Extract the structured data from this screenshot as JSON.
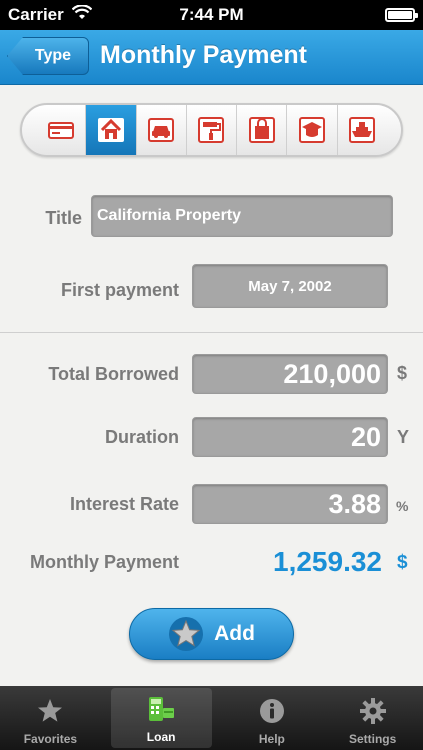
{
  "status_bar": {
    "carrier": "Carrier",
    "time": "7:44 PM"
  },
  "nav": {
    "back_label": "Type",
    "title": "Monthly Payment"
  },
  "type_selector": {
    "items": [
      {
        "icon": "credit-card-icon",
        "selected": false
      },
      {
        "icon": "house-icon",
        "selected": true
      },
      {
        "icon": "car-icon",
        "selected": false
      },
      {
        "icon": "paint-roller-icon",
        "selected": false
      },
      {
        "icon": "shopping-bag-icon",
        "selected": false
      },
      {
        "icon": "graduation-cap-icon",
        "selected": false
      },
      {
        "icon": "boat-icon",
        "selected": false
      }
    ],
    "accent": "#d63b2f"
  },
  "form": {
    "title_label": "Title",
    "title_value": "California Property",
    "first_payment_label": "First payment",
    "first_payment_value": "May 7, 2002",
    "total_borrowed_label": "Total Borrowed",
    "total_borrowed_value": "210,000",
    "total_borrowed_unit": "$",
    "duration_label": "Duration",
    "duration_value": "20",
    "duration_unit": "Y",
    "interest_rate_label": "Interest Rate",
    "interest_rate_value": "3.88",
    "interest_rate_unit": "%",
    "monthly_payment_label": "Monthly Payment",
    "monthly_payment_value": "1,259.32",
    "monthly_payment_unit": "$"
  },
  "add_button": {
    "label": "Add"
  },
  "tab_bar": {
    "tabs": [
      {
        "label": "Favorites",
        "icon": "star-icon",
        "active": false
      },
      {
        "label": "Loan",
        "icon": "calculator-money-icon",
        "active": true
      },
      {
        "label": "Help",
        "icon": "info-icon",
        "active": false
      },
      {
        "label": "Settings",
        "icon": "gear-icon",
        "active": false
      }
    ]
  },
  "colors": {
    "brand": "#1a86cc",
    "result": "#1a8fd6"
  }
}
